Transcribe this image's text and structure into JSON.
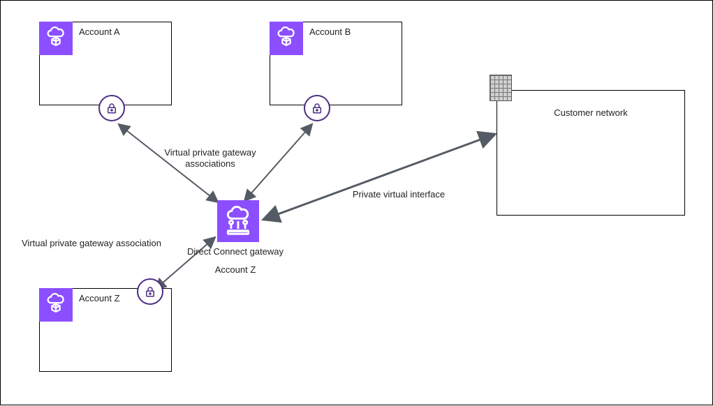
{
  "accounts": {
    "a": {
      "label": "Account A"
    },
    "b": {
      "label": "Account B"
    },
    "z": {
      "label": "Account Z"
    }
  },
  "customer": {
    "label": "Customer network"
  },
  "hub": {
    "title": "Direct Connect gateway",
    "owner": "Account Z"
  },
  "labels": {
    "vpg_associations": "Virtual private gateway\nassociations",
    "vpg_association": "Virtual private gateway association",
    "pvi": "Private virtual interface"
  }
}
